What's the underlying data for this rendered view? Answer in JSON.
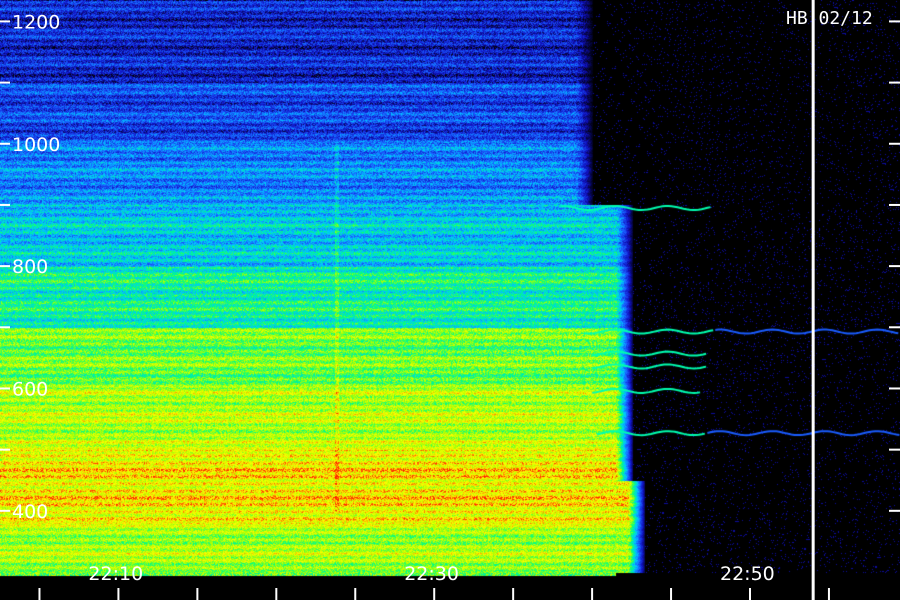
{
  "station_tag": "HB 02/12",
  "chart_data": {
    "type": "heatmap",
    "title": "",
    "xlabel": "",
    "ylabel": "",
    "x_axis": {
      "tick_labels": [
        "22:10",
        "22:30",
        "22:50"
      ],
      "tick_values_min": [
        10,
        30,
        50
      ],
      "range_min": [
        2.5,
        59.5
      ],
      "minor_tick_step_min": 5
    },
    "y_axis": {
      "tick_labels": [
        "1200",
        "1000",
        "800",
        "600",
        "400"
      ],
      "tick_values": [
        1200,
        1000,
        800,
        600,
        400
      ],
      "range": [
        300,
        1235
      ],
      "minor_tick_step": 100
    },
    "colormap": [
      "#000000",
      "#1010c0",
      "#1a5cff",
      "#00c8ff",
      "#00ff80",
      "#b0ff00",
      "#ffff00",
      "#ff2000"
    ],
    "intensity_bands": [
      {
        "f_from": 1100,
        "f_to": 1235,
        "level": 0.18
      },
      {
        "f_from": 1000,
        "f_to": 1100,
        "level": 0.24
      },
      {
        "f_from": 900,
        "f_to": 1000,
        "level": 0.34
      },
      {
        "f_from": 800,
        "f_to": 900,
        "level": 0.44
      },
      {
        "f_from": 700,
        "f_to": 800,
        "level": 0.54
      },
      {
        "f_from": 600,
        "f_to": 700,
        "level": 0.66
      },
      {
        "f_from": 500,
        "f_to": 600,
        "level": 0.74
      },
      {
        "f_from": 380,
        "f_to": 500,
        "level": 0.84
      },
      {
        "f_from": 300,
        "f_to": 380,
        "level": 0.72
      }
    ],
    "emission_end_min": 41.5,
    "discontinuity_min": 23.8,
    "marker_line_min": 54.0,
    "line_emissions": [
      {
        "f": 895,
        "t_from": 38.0,
        "t_to": 47.6
      },
      {
        "f": 693,
        "t_from": 39.5,
        "t_to": 47.8
      },
      {
        "f": 657,
        "t_from": 40.0,
        "t_to": 47.3
      },
      {
        "f": 636,
        "t_from": 40.0,
        "t_to": 47.3
      },
      {
        "f": 596,
        "t_from": 40.0,
        "t_to": 47.0
      },
      {
        "f": 527,
        "t_from": 40.3,
        "t_to": 47.3
      },
      {
        "f": 693,
        "t_from": 47.8,
        "t_to": 59.5
      },
      {
        "f": 527,
        "t_from": 47.3,
        "t_to": 59.5
      }
    ]
  }
}
